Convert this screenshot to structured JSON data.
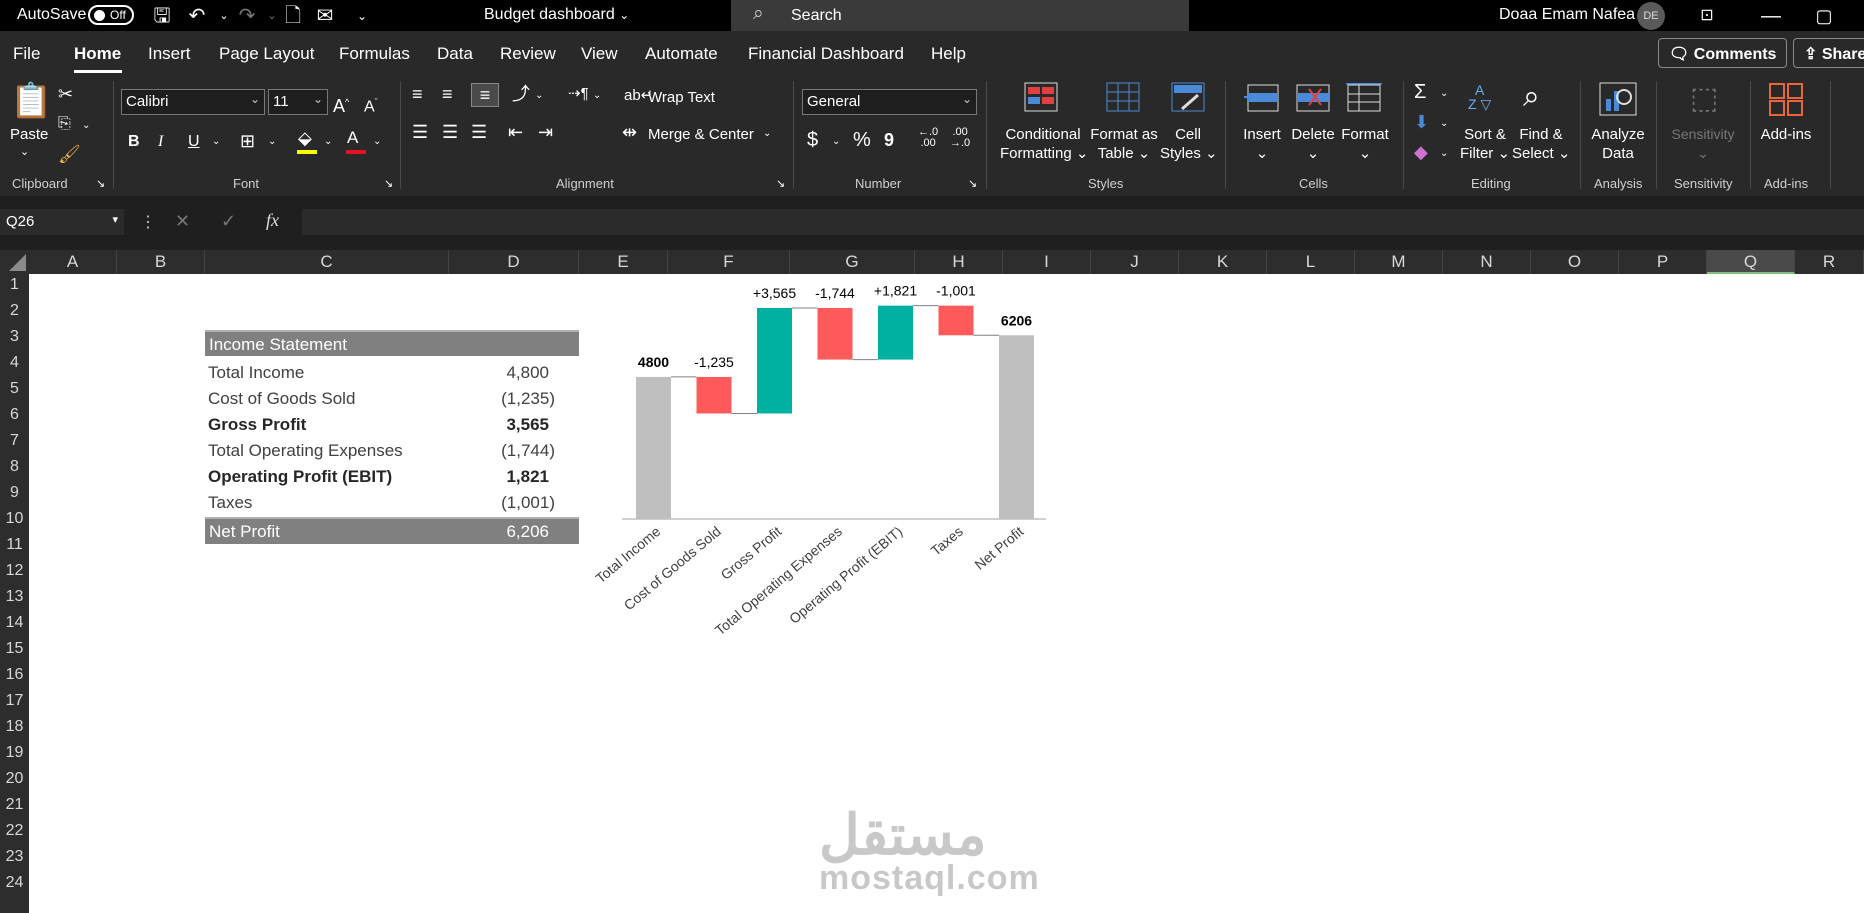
{
  "titlebar": {
    "autosave_label": "AutoSave",
    "autosave_state": "Off",
    "doc_title": "Budget dashboard",
    "search_placeholder": "Search",
    "user_name": "Doaa Emam Nafea",
    "user_initials": "DE"
  },
  "menu": {
    "tabs": [
      "File",
      "Home",
      "Insert",
      "Page Layout",
      "Formulas",
      "Data",
      "Review",
      "View",
      "Automate",
      "Financial Dashboard",
      "Help"
    ],
    "active": "Home",
    "comments_label": "Comments",
    "share_label": "Share"
  },
  "ribbon": {
    "clipboard": {
      "paste": "Paste",
      "group": "Clipboard"
    },
    "font": {
      "name": "Calibri",
      "size": "11",
      "group": "Font",
      "bold": "B",
      "italic": "I",
      "underline": "U"
    },
    "alignment": {
      "wrap": "Wrap Text",
      "merge": "Merge & Center",
      "group": "Alignment"
    },
    "number": {
      "format": "General",
      "group": "Number",
      "currency": "$",
      "percent": "%",
      "comma": "9"
    },
    "styles": {
      "conditional1": "Conditional",
      "conditional2": "Formatting",
      "format_table1": "Format as",
      "format_table2": "Table",
      "cell_styles1": "Cell",
      "cell_styles2": "Styles",
      "group": "Styles"
    },
    "cells": {
      "insert": "Insert",
      "delete": "Delete",
      "format": "Format",
      "group": "Cells"
    },
    "editing": {
      "sort1": "Sort &",
      "sort2": "Filter",
      "find1": "Find &",
      "find2": "Select",
      "group": "Editing"
    },
    "analysis": {
      "analyze1": "Analyze",
      "analyze2": "Data",
      "group": "Analysis"
    },
    "sensitivity": {
      "label": "Sensitivity",
      "group": "Sensitivity"
    },
    "addins": {
      "label": "Add-ins",
      "group": "Add-ins"
    }
  },
  "formula_bar": {
    "name_box": "Q26",
    "fx": "fx",
    "content": ""
  },
  "columns": [
    "A",
    "B",
    "C",
    "D",
    "E",
    "F",
    "G",
    "H",
    "I",
    "J",
    "K",
    "L",
    "M",
    "N",
    "O",
    "P",
    "Q",
    "R"
  ],
  "selected_column": "Q",
  "rows": [
    "1",
    "2",
    "3",
    "4",
    "5",
    "6",
    "7",
    "8",
    "9",
    "10",
    "11",
    "12",
    "13",
    "14",
    "15",
    "16",
    "17",
    "18",
    "19",
    "20",
    "21",
    "22",
    "23",
    "24"
  ],
  "income_statement": {
    "header": "Income Statement",
    "lines": [
      {
        "label": "Total Income",
        "value": "4,800",
        "bold": false
      },
      {
        "label": "Cost of Goods Sold",
        "value": "(1,235)",
        "bold": false
      },
      {
        "label": "Gross Profit",
        "value": "3,565",
        "bold": true
      },
      {
        "label": "Total Operating Expenses",
        "value": "(1,744)",
        "bold": false
      },
      {
        "label": "Operating Profit (EBIT)",
        "value": "1,821",
        "bold": true
      },
      {
        "label": "Taxes",
        "value": "(1,001)",
        "bold": false
      }
    ],
    "total": {
      "label": "Net Profit",
      "value": "6,206"
    }
  },
  "chart_data": {
    "type": "bar",
    "subtype": "waterfall",
    "title": "",
    "categories": [
      "Total Income",
      "Cost of Goods Sold",
      "Gross Profit",
      "Total Operating Expenses",
      "Operating Profit (EBIT)",
      "Taxes",
      "Net Profit"
    ],
    "values": [
      4800,
      -1235,
      3565,
      -1744,
      1821,
      -1001,
      6206
    ],
    "data_labels": [
      "4800",
      "-1,235",
      "+3,565",
      "-1,744",
      "+1,821",
      "-1,001",
      "6206"
    ],
    "kinds": [
      "total",
      "decrease",
      "increase",
      "decrease",
      "increase",
      "decrease",
      "total"
    ],
    "colors": {
      "total": "#bfbfbf",
      "increase": "#00b0a0",
      "decrease": "#ff5a5a"
    },
    "ylim": [
      0,
      8000
    ],
    "grid": false,
    "legend": "none"
  },
  "watermark": {
    "arabic": "مستقل",
    "latin": "mostaql.com"
  }
}
